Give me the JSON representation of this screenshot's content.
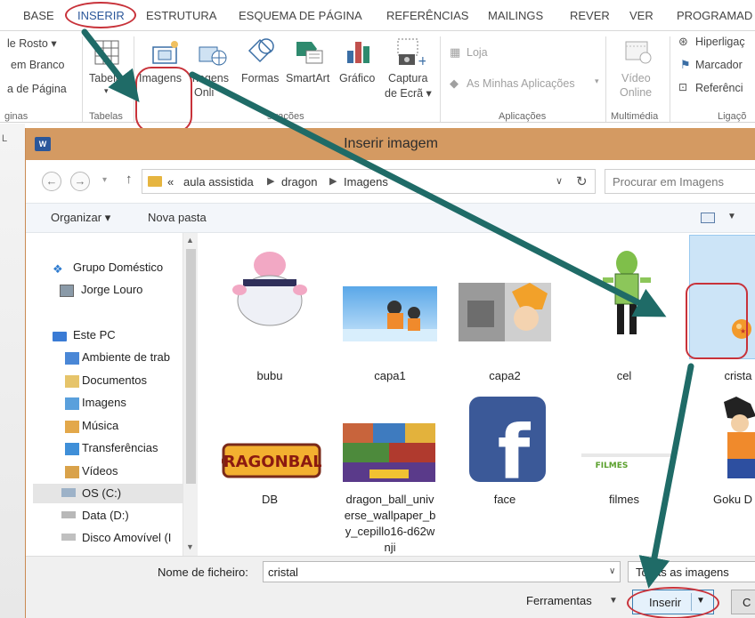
{
  "ribbon_tabs": [
    "BASE",
    "INSERIR",
    "ESTRUTURA",
    "ESQUEMA DE PÁGINA",
    "REFERÊNCIAS",
    "MAILINGS",
    "REVER",
    "VER",
    "PROGRAMAD"
  ],
  "ribbon": {
    "header_footer": [
      "le Rosto ▾",
      "em Branco",
      "a de Página"
    ],
    "pages_group": "ginas",
    "table_label": "Tabela",
    "tables_group": "Tabelas",
    "images_label": "Imagens",
    "online_images_label": [
      "nagens",
      "Onli"
    ],
    "shapes_label": "Formas",
    "smartart_label": "SmartArt",
    "chart_label": "Gráfico",
    "screenshot_label": [
      "Captura",
      "de Ecrã ▾"
    ],
    "illustrations_group": "strações",
    "store_label": "Loja",
    "my_apps_label": "As Minhas Aplicações",
    "apps_group": "Aplicações",
    "video_label": [
      "Vídeo",
      "Online"
    ],
    "media_group": "Multimédia",
    "hyperlink_label": "Hiperligaç",
    "bookmark_label": "Marcador",
    "crossref_label": "Referênci",
    "links_group": "Ligaçõ"
  },
  "dialog": {
    "title": "Inserir imagem",
    "breadcrumb": [
      "«",
      "aula assistida",
      "dragon",
      "Imagens"
    ],
    "search_placeholder": "Procurar em Imagens",
    "organize_label": "Organizar ▾",
    "new_folder_label": "Nova pasta",
    "nav_items": [
      "Grupo Doméstico",
      "Jorge Louro",
      "Este PC",
      "Ambiente de trab",
      "Documentos",
      "Imagens",
      "Música",
      "Transferências",
      "Vídeos",
      "OS (C:)",
      "Data (D:)",
      "Disco Amovível (I"
    ],
    "files": [
      {
        "name": "bubu"
      },
      {
        "name": "capa1"
      },
      {
        "name": "capa2"
      },
      {
        "name": "cel"
      },
      {
        "name": "crista"
      },
      {
        "name": "DB"
      },
      {
        "name": "dragon_ball_universe_wallpaper_by_cepillo16-d62wnji",
        "lines": [
          "dragon_ball_univ",
          "erse_wallpaper_b",
          "y_cepillo16-d62w",
          "nji"
        ]
      },
      {
        "name": "face"
      },
      {
        "name": "filmes"
      },
      {
        "name": "Goku D"
      }
    ],
    "filename_label": "Nome de ficheiro:",
    "filename_value": "cristal",
    "filetype_value": "Todas as imagens",
    "tools_label": "Ferramentas",
    "insert_label": "Inserir",
    "cancel_label": "C"
  },
  "colors": {
    "accent_blue": "#2b579a",
    "dialog_title": "#d49a62",
    "annotation_arrow": "#1f6b67",
    "annotation_ring": "#c8323a",
    "selection": "#cce4f7"
  },
  "icons": [
    "cover-page-icon",
    "table-icon",
    "picture-icon",
    "online-picture-icon",
    "shapes-icon",
    "smartart-icon",
    "chart-icon",
    "screenshot-icon",
    "store-icon",
    "apps-icon",
    "video-icon",
    "hyperlink-icon",
    "bookmark-icon",
    "crossref-icon",
    "word-icon",
    "back-icon",
    "forward-icon",
    "up-icon",
    "folder-icon",
    "refresh-icon",
    "view-icon"
  ]
}
